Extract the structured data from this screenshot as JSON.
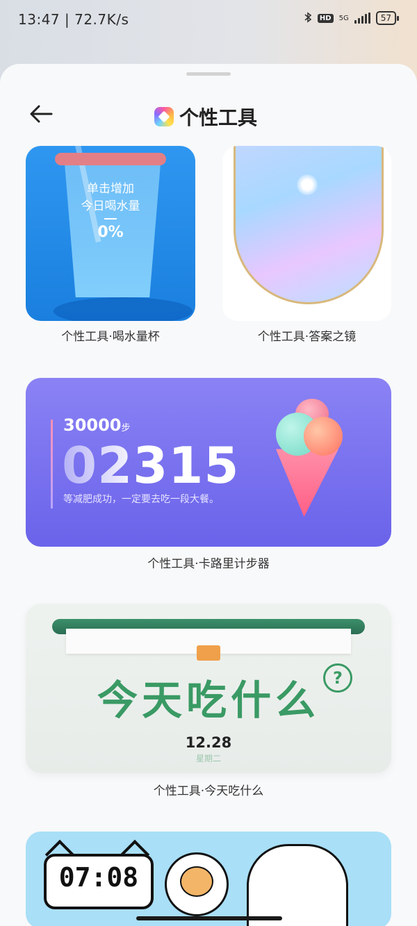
{
  "status_bar": {
    "time": "13:47",
    "net_speed": "72.7K/s",
    "network": "5G",
    "hd": "HD",
    "battery": "57"
  },
  "header": {
    "title": "个性工具",
    "back_icon": "arrow-left-icon",
    "app_icon": "personal-tools-icon"
  },
  "cards": {
    "water": {
      "line1": "单击增加",
      "line2": "今日喝水量",
      "dash": "—",
      "percent": "0%",
      "label": "个性工具·喝水量杯"
    },
    "mirror": {
      "label": "个性工具·答案之镜"
    },
    "calorie": {
      "goal": "30000",
      "goal_unit": "步",
      "steps": "02315",
      "desc": "等减肥成功，一定要去吃一段大餐。",
      "label": "个性工具·卡路里计步器"
    },
    "food": {
      "title": "今天吃什么",
      "question": "?",
      "date": "12.28",
      "weekday": "星期二",
      "label": "个性工具·今天吃什么"
    },
    "clock": {
      "time": "07:08"
    }
  }
}
